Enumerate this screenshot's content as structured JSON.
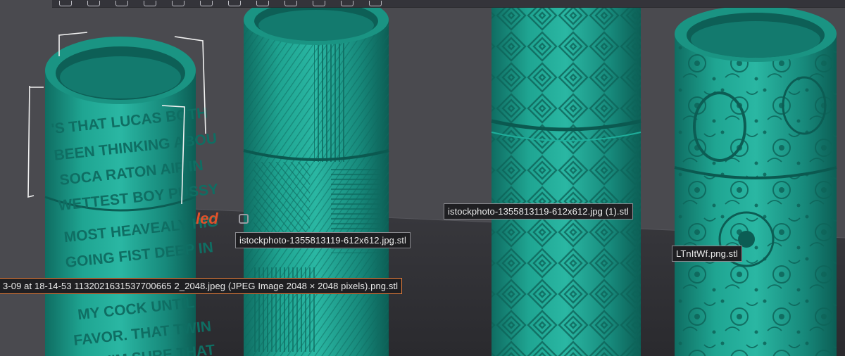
{
  "viewport": {
    "background": "#4a4a4f",
    "plate_color": "#2f2f33",
    "model_color": "#1e9e8c",
    "selection_color": "#e07a3a",
    "plate_label": "led"
  },
  "toolbar": {
    "tools": [
      "add-icon",
      "grid-icon",
      "arrange-icon",
      "layers-icon",
      "rotate-icon",
      "move-icon",
      "scale-icon",
      "cut-icon",
      "support-icon",
      "view-icon",
      "measure-icon",
      "settings-icon"
    ]
  },
  "objects": [
    {
      "name": "3-09 at 18-14-53 1132021631537700665 2_2048.jpeg (JPEG Image 2048 × 2048 pixels).png.stl",
      "selected": true,
      "engraving": [
        "'S THAT LUCAS BOTH",
        "BEEN THINKING ABOU",
        "SOCA RATON AIP IN",
        "WETTEST BOY PUSSY",
        "MOST HEAVEALY HIG",
        "GOING FIST DEEP IN",
        "MY COCK UNTIL",
        "FAVOR. THAT TWIN",
        "BUT I'M SURE THAT"
      ]
    },
    {
      "name": "istockphoto-1355813119-612x612.jpg.stl",
      "selected": false
    },
    {
      "name": "istockphoto-1355813119-612x612.jpg (1).stl",
      "selected": false
    },
    {
      "name": "LTnItWf.png.stl",
      "selected": false
    }
  ]
}
